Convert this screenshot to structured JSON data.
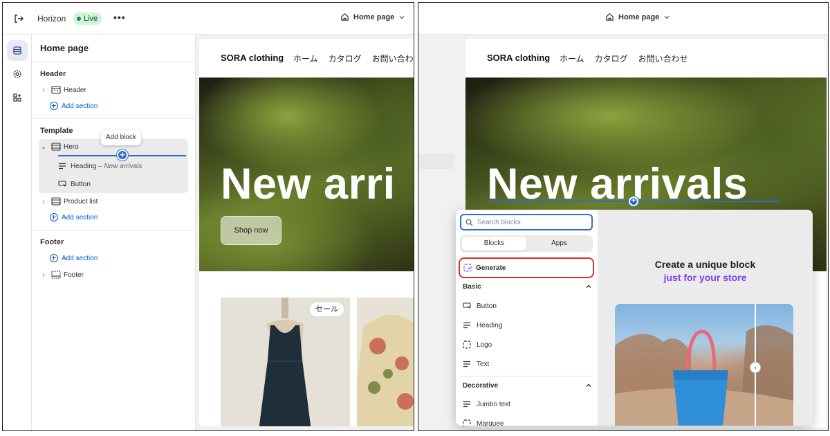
{
  "topbar": {
    "theme_name": "Horizon",
    "status": "Live",
    "more_label": "•••",
    "page_selector": "Home page"
  },
  "sidebar": {
    "title": "Home page",
    "header_group": "Header",
    "header_item": "Header",
    "add_section": "Add section",
    "template_group": "Template",
    "hero_item": "Hero",
    "tooltip": "Add block",
    "hero_children": [
      {
        "label": "Heading",
        "sub": "– New arrivals"
      },
      {
        "label": "Button",
        "sub": ""
      }
    ],
    "product_list_item": "Product list",
    "footer_group": "Footer",
    "footer_item": "Footer"
  },
  "preview": {
    "brand": "SORA clothing",
    "nav": [
      "ホーム",
      "カタログ",
      "お問い合わせ"
    ],
    "hero_heading_left": "New arri",
    "hero_heading_right": "New arrivals",
    "shop_button": "Shop now",
    "sale_badge": "セール"
  },
  "picker": {
    "search_placeholder": "Search blocks",
    "tabs": [
      "Blocks",
      "Apps"
    ],
    "active_tab": "Blocks",
    "generate": "Generate",
    "basic_group": "Basic",
    "basic_items": [
      {
        "label": "Button",
        "icon": "button-icon"
      },
      {
        "label": "Heading",
        "icon": "heading-icon"
      },
      {
        "label": "Logo",
        "icon": "logo-icon"
      },
      {
        "label": "Text",
        "icon": "text-icon"
      }
    ],
    "decorative_group": "Decorative",
    "decorative_items": [
      {
        "label": "Jumbo text",
        "icon": "jumbo-text-icon"
      },
      {
        "label": "Marquee",
        "icon": "marquee-icon"
      }
    ],
    "promo_line1": "Create a unique block",
    "promo_line2": "just for your store"
  },
  "colors": {
    "accent": "#2c6ecb",
    "live_bg": "#cdf5d6",
    "highlight": "#e02d2d",
    "promo_purple": "#7a3ff1"
  }
}
